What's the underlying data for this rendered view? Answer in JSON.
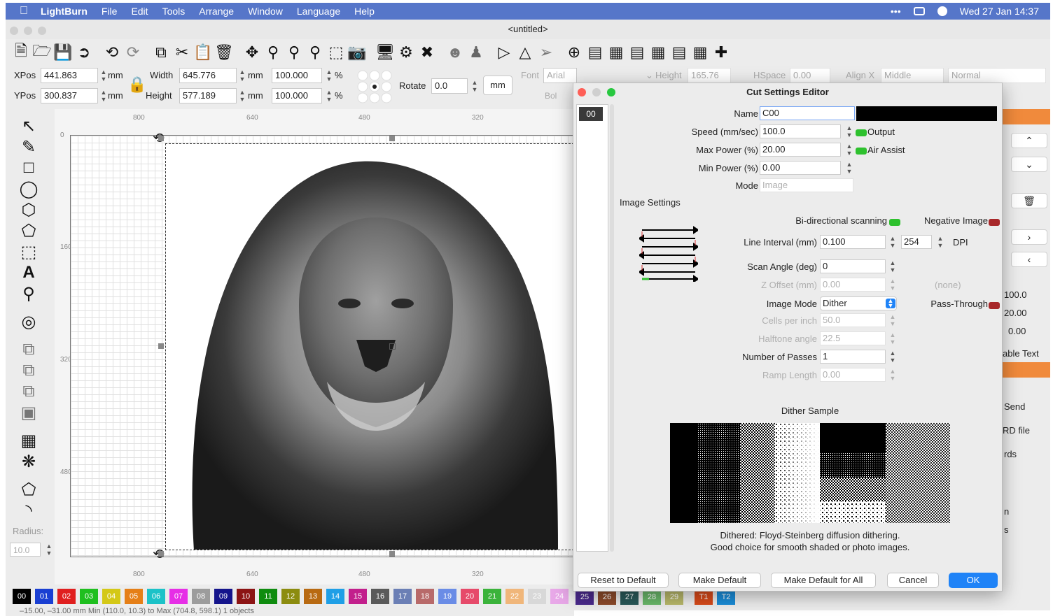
{
  "menubar": {
    "app": "LightBurn",
    "items": [
      "File",
      "Edit",
      "Tools",
      "Arrange",
      "Window",
      "Language",
      "Help"
    ],
    "clock": "Wed 27 Jan  14:37",
    "dots": "•••"
  },
  "window": {
    "title": "<untitled>"
  },
  "toolbar": {
    "icons": [
      "new-file-icon",
      "open-icon",
      "save-icon",
      "import-icon",
      "undo-icon",
      "redo-icon",
      "copy-icon",
      "cut-icon",
      "paste-icon",
      "delete-icon",
      "move-icon",
      "zoom-in-icon",
      "zoom-out-icon",
      "zoom-fit-icon",
      "frame-icon",
      "camera-icon",
      "monitor-icon",
      "settings-icon",
      "tools-icon",
      "group-icon",
      "user-icon",
      "flip-icon",
      "mirror-icon",
      "arrow-icon",
      "target-icon",
      "align-icon",
      "distribute-icon",
      "align-v-icon",
      "distribute-v-icon",
      "align-top-icon",
      "align-mid-icon",
      "center-icon"
    ]
  },
  "props": {
    "xpos_label": "XPos",
    "xpos": "441.863",
    "ypos_label": "YPos",
    "ypos": "300.837",
    "unit": "mm",
    "width_label": "Width",
    "width": "645.776",
    "height_label": "Height",
    "height": "577.189",
    "scale_x": "100.000",
    "scale_y": "100.000",
    "pct": "%",
    "rotate_label": "Rotate",
    "rotate": "0.0",
    "mm_button": "mm",
    "font_label": "Font",
    "font": "Arial",
    "text_height_label": "Height",
    "text_height": "165.76",
    "hspace_label": "HSpace",
    "hspace": "0.00",
    "alignx_label": "Align X",
    "alignx": "Middle",
    "normal": "Normal",
    "bold": "Bol"
  },
  "rulers": {
    "top": [
      "800",
      "640",
      "480",
      "320"
    ],
    "bottom": [
      "800",
      "640",
      "480",
      "320"
    ],
    "left": [
      "0",
      "160",
      "320",
      "480"
    ]
  },
  "lefttools": {
    "radius_label": "Radius:",
    "radius": "10.0"
  },
  "palette": [
    {
      "id": "00",
      "color": "#000000"
    },
    {
      "id": "01",
      "color": "#1a3fd2"
    },
    {
      "id": "02",
      "color": "#e01f1f"
    },
    {
      "id": "03",
      "color": "#1fbf1f"
    },
    {
      "id": "04",
      "color": "#d4c817"
    },
    {
      "id": "05",
      "color": "#e57f17"
    },
    {
      "id": "06",
      "color": "#1cc2c8"
    },
    {
      "id": "07",
      "color": "#e62ee6"
    },
    {
      "id": "08",
      "color": "#9c9c9c"
    },
    {
      "id": "09",
      "color": "#15158c"
    },
    {
      "id": "10",
      "color": "#8c1414"
    },
    {
      "id": "11",
      "color": "#0f8c0f"
    },
    {
      "id": "12",
      "color": "#8c8c0f"
    },
    {
      "id": "13",
      "color": "#b86a12"
    },
    {
      "id": "14",
      "color": "#1f9fe6"
    },
    {
      "id": "15",
      "color": "#c21f8c"
    },
    {
      "id": "16",
      "color": "#5a5a5a"
    },
    {
      "id": "17",
      "color": "#6b7fb5"
    },
    {
      "id": "18",
      "color": "#b86a6a"
    },
    {
      "id": "19",
      "color": "#6a8ce6"
    },
    {
      "id": "20",
      "color": "#e64a6a"
    },
    {
      "id": "21",
      "color": "#3bb33b"
    },
    {
      "id": "22",
      "color": "#f0b67a"
    },
    {
      "id": "23",
      "color": "#d8d8d8"
    },
    {
      "id": "24",
      "color": "#e8a8e8"
    },
    {
      "id": "25",
      "color": "#4a2a8c"
    },
    {
      "id": "26",
      "color": "#8c4a2a"
    },
    {
      "id": "27",
      "color": "#2a5a5a"
    },
    {
      "id": "28",
      "color": "#6ab86a"
    },
    {
      "id": "29",
      "color": "#b8b86a"
    },
    {
      "id": "T1",
      "color": "#d84a1a"
    },
    {
      "id": "T2",
      "color": "#1a8cd8"
    }
  ],
  "status": "‒15.00, ‒31.00 mm  Min (110.0, 10.3) to Max (704.8, 598.1)  1 objects",
  "rightpanel": {
    "v1": "100.0",
    "v2": "20.00",
    "v3": "0.00",
    "readable_text": "able Text",
    "send": "Send",
    "rd_file": "RD file",
    "rds": "rds",
    "n": "n",
    "s": "s"
  },
  "dialog": {
    "title": "Cut Settings Editor",
    "layer": "00",
    "name_label": "Name",
    "name": "C00",
    "speed_label": "Speed (mm/sec)",
    "speed": "100.0",
    "maxpower_label": "Max Power (%)",
    "maxpower": "20.00",
    "minpower_label": "Min Power (%)",
    "minpower": "0.00",
    "output_label": "Output",
    "airassist_label": "Air Assist",
    "mode_label": "Mode",
    "mode": "Image",
    "image_settings": "Image Settings",
    "bidir_label": "Bi-directional scanning",
    "negative_label": "Negative Image",
    "interval_label": "Line Interval (mm)",
    "interval": "0.100",
    "dpi": "254",
    "dpi_label": "DPI",
    "scanangle_label": "Scan Angle (deg)",
    "scanangle": "0",
    "zoffset_label": "Z Offset (mm)",
    "zoffset": "0.00",
    "none": "(none)",
    "imagemode_label": "Image Mode",
    "imagemode": "Dither",
    "passthrough_label": "Pass-Through",
    "cells_label": "Cells per inch",
    "cells": "50.0",
    "halftone_label": "Halftone angle",
    "halftone": "22.5",
    "passes_label": "Number of Passes",
    "passes": "1",
    "ramp_label": "Ramp Length",
    "ramp": "0.00",
    "dither_sample": "Dither Sample",
    "desc1": "Dithered: Floyd-Steinberg diffusion dithering.",
    "desc2": "Good choice for smooth shaded or photo images.",
    "btn_reset": "Reset to Default",
    "btn_make": "Make Default",
    "btn_makeall": "Make Default for All",
    "btn_cancel": "Cancel",
    "btn_ok": "OK"
  }
}
